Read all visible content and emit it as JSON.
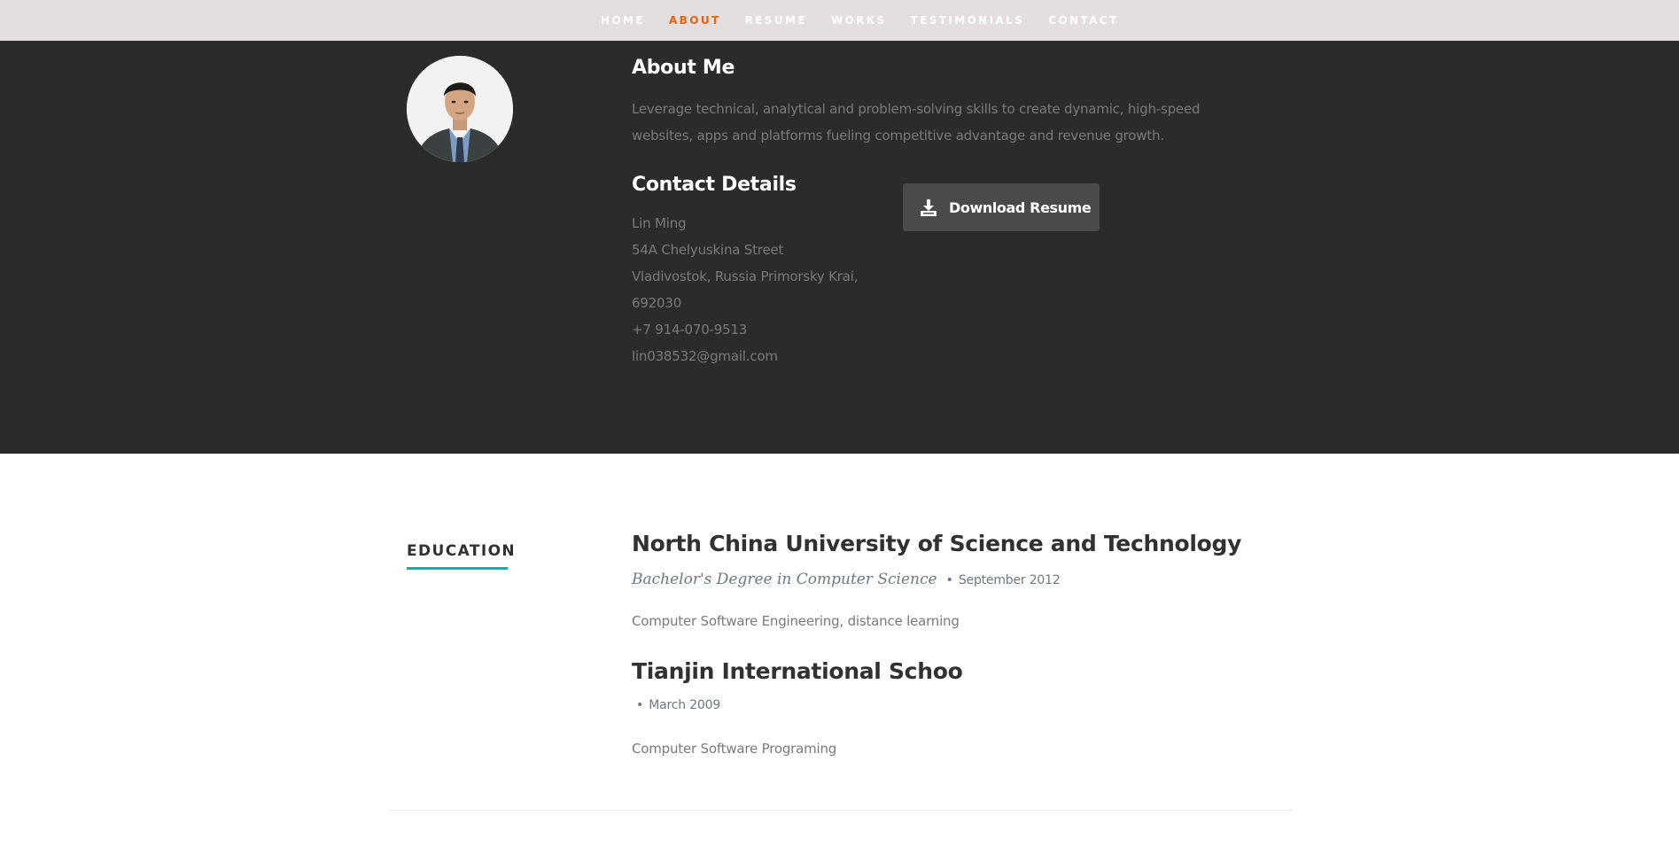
{
  "nav": {
    "items": [
      {
        "label": "HOME",
        "active": false
      },
      {
        "label": "ABOUT",
        "active": true
      },
      {
        "label": "RESUME",
        "active": false
      },
      {
        "label": "WORKS",
        "active": false
      },
      {
        "label": "TESTIMONIALS",
        "active": false
      },
      {
        "label": "CONTACT",
        "active": false
      }
    ]
  },
  "about": {
    "title": "About Me",
    "text": "Leverage technical, analytical and problem-solving skills to create dynamic, high-speed websites, apps and platforms fueling competitive advantage and revenue growth.",
    "contact_title": "Contact Details",
    "contact": {
      "name": "Lin Ming",
      "street": "54A Chelyuskina Street",
      "city": "Vladivostok, Russia Primorsky Krai,",
      "zip": "692030",
      "phone": "+7 914-070-9513",
      "email": "lin038532@gmail.com"
    },
    "download_label": "Download Resume",
    "download_icon": "download-icon",
    "avatar_icon": "profile-photo"
  },
  "education": {
    "heading": "EDUCATION",
    "entries": [
      {
        "school": "North China University of Science and Technology",
        "degree": "Bachelor's Degree in Computer Science",
        "bullet": "•",
        "date": "September 2012",
        "description": "Computer Software Engineering, distance learning"
      },
      {
        "school": "Tianjin International Schoo",
        "degree": "",
        "bullet": "•",
        "date": "March 2009",
        "description": "Computer Software Programing"
      }
    ]
  },
  "colors": {
    "nav_bg": "#e5dedf",
    "nav_active": "#e8610d",
    "about_bg": "#2b2b2b",
    "button_bg": "#4a4a4a",
    "accent": "#11abb0"
  }
}
